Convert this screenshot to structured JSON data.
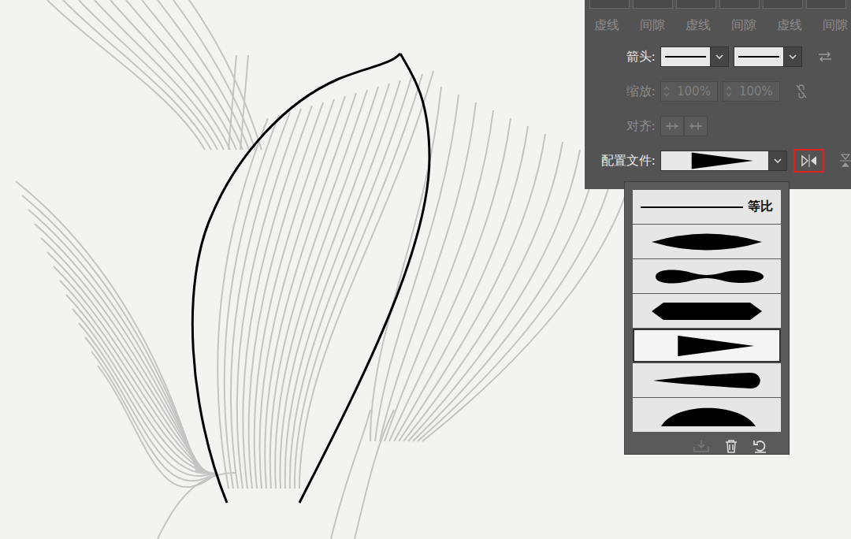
{
  "dash_row": {
    "labels": [
      "虚线",
      "间隙",
      "虚线",
      "间隙",
      "虚线",
      "间隙"
    ],
    "disabled": true
  },
  "arrows": {
    "label": "箭头:"
  },
  "scale": {
    "label": "缩放:",
    "disabled": true,
    "start": "100%",
    "end": "100%"
  },
  "align": {
    "label": "对齐:",
    "disabled": true
  },
  "profile": {
    "label": "配置文件:",
    "flip_highlighted": true
  },
  "profile_menu": {
    "items": [
      {
        "kind": "uniform",
        "label": "等比",
        "selected": false
      },
      {
        "kind": "lens",
        "selected": false
      },
      {
        "kind": "wavy",
        "selected": false
      },
      {
        "kind": "hex",
        "selected": false
      },
      {
        "kind": "triangle",
        "selected": true
      },
      {
        "kind": "taper",
        "selected": false
      },
      {
        "kind": "dome",
        "selected": false
      }
    ]
  }
}
